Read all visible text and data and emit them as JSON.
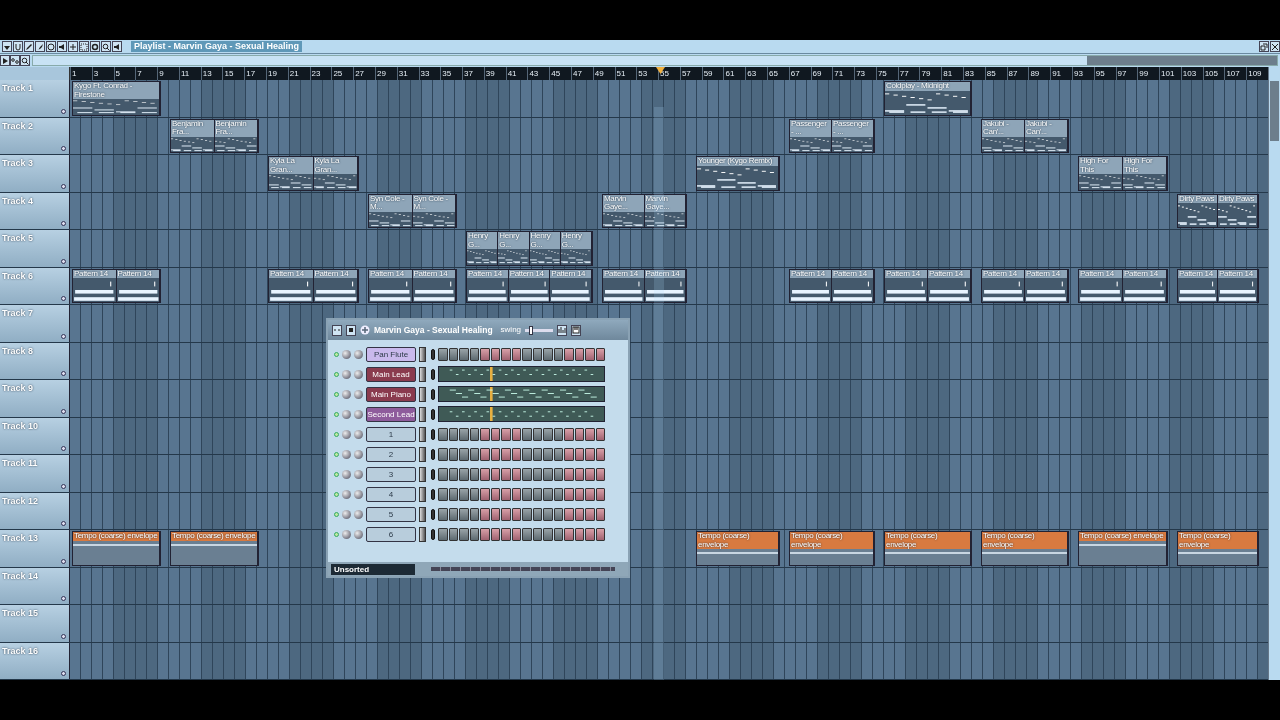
{
  "window": {
    "title": "Playlist - Marvin Gaya - Sexual Healing"
  },
  "ruler": {
    "marks": [
      "1",
      "3",
      "5",
      "7",
      "9",
      "11",
      "13",
      "15",
      "17",
      "19",
      "21",
      "23",
      "25",
      "27",
      "29",
      "31",
      "33",
      "35",
      "37",
      "39",
      "41",
      "43",
      "45",
      "47",
      "49",
      "51",
      "53",
      "55",
      "57",
      "59",
      "61",
      "63",
      "65",
      "67",
      "69",
      "71",
      "73",
      "75",
      "77",
      "79",
      "81",
      "83",
      "85",
      "87",
      "89",
      "91",
      "93",
      "95",
      "97",
      "99",
      "101",
      "103",
      "105",
      "107",
      "109"
    ]
  },
  "tracks": [
    {
      "name": "Track 1",
      "lane": [
        {
          "kind": "clip",
          "parts": [
            "Kygo Ft. Conrad - Firestone"
          ]
        },
        {
          "kind": "empty"
        },
        {
          "kind": "empty"
        },
        {
          "kind": "empty"
        },
        {
          "kind": "empty"
        },
        {
          "kind": "empty"
        },
        {
          "kind": "empty"
        },
        {
          "kind": "empty"
        },
        {
          "kind": "clip",
          "parts": [
            "Coldplay - Midnight"
          ]
        }
      ]
    },
    {
      "name": "Track 2",
      "lane": [
        {
          "kind": "empty"
        },
        {
          "kind": "clip",
          "parts": [
            "Benjamin Fra...",
            "Benjamin Fra..."
          ]
        },
        {
          "kind": "empty"
        },
        {
          "kind": "empty"
        },
        {
          "kind": "empty"
        },
        {
          "kind": "empty"
        },
        {
          "kind": "empty"
        },
        {
          "kind": "clip",
          "parts": [
            "Passenger - ...",
            "Passenger - ..."
          ]
        },
        {
          "kind": "empty"
        },
        {
          "kind": "clip",
          "parts": [
            "Jakubi - Can'...",
            "Jakubi - Can'..."
          ]
        }
      ]
    },
    {
      "name": "Track 3",
      "lane": [
        {
          "kind": "empty"
        },
        {
          "kind": "empty"
        },
        {
          "kind": "clip",
          "parts": [
            "Kyla La Gran...",
            "Kyla La Gran..."
          ]
        },
        {
          "kind": "empty"
        },
        {
          "kind": "empty"
        },
        {
          "kind": "empty"
        },
        {
          "kind": "clip",
          "parts": [
            "Younger (Kygo Remix)"
          ]
        },
        {
          "kind": "empty"
        },
        {
          "kind": "empty"
        },
        {
          "kind": "empty"
        },
        {
          "kind": "clip",
          "parts": [
            "High For This",
            "High For This"
          ]
        }
      ]
    },
    {
      "name": "Track 4",
      "lane": [
        {
          "kind": "empty"
        },
        {
          "kind": "empty"
        },
        {
          "kind": "empty"
        },
        {
          "kind": "clip",
          "parts": [
            "Syn Cole - M...",
            "Syn Cole - M..."
          ]
        },
        {
          "kind": "empty"
        },
        {
          "kind": "clip",
          "parts": [
            "Marvin Gaye...",
            "Marvin Gaye..."
          ]
        },
        {
          "kind": "empty"
        },
        {
          "kind": "empty"
        },
        {
          "kind": "empty"
        },
        {
          "kind": "empty"
        },
        {
          "kind": "empty"
        },
        {
          "kind": "clip",
          "parts": [
            "Dirty Paws",
            "Dirty Paws"
          ]
        }
      ]
    },
    {
      "name": "Track 5",
      "lane": [
        {
          "kind": "empty"
        },
        {
          "kind": "empty"
        },
        {
          "kind": "empty"
        },
        {
          "kind": "empty"
        },
        {
          "kind": "clip",
          "parts": [
            "Henry G...",
            "Henry G...",
            "Henry G...",
            "Henry G..."
          ]
        }
      ]
    },
    {
      "name": "Track 6",
      "lane": [
        {
          "kind": "pattern",
          "parts": [
            "Pattern 14",
            "Pattern 14"
          ]
        },
        {
          "kind": "empty"
        },
        {
          "kind": "pattern",
          "parts": [
            "Pattern 14",
            "Pattern 14"
          ]
        },
        {
          "kind": "pattern",
          "parts": [
            "Pattern 14",
            "Pattern 14"
          ]
        },
        {
          "kind": "pattern",
          "parts": [
            "Pattern 14",
            "Pattern 14",
            "Pattern 14"
          ]
        },
        {
          "kind": "pattern",
          "parts": [
            "Pattern 14",
            "Pattern 14"
          ]
        },
        {
          "kind": "empty"
        },
        {
          "kind": "pattern",
          "parts": [
            "Pattern 14",
            "Pattern 14"
          ]
        },
        {
          "kind": "pattern",
          "parts": [
            "Pattern 14",
            "Pattern 14"
          ]
        },
        {
          "kind": "pattern",
          "parts": [
            "Pattern 14",
            "Pattern 14"
          ]
        },
        {
          "kind": "pattern",
          "parts": [
            "Pattern 14",
            "Pattern 14"
          ]
        },
        {
          "kind": "pattern",
          "parts": [
            "Pattern 14",
            "Pattern 14"
          ]
        }
      ]
    },
    {
      "name": "Track 7"
    },
    {
      "name": "Track 8"
    },
    {
      "name": "Track 9"
    },
    {
      "name": "Track 10"
    },
    {
      "name": "Track 11"
    },
    {
      "name": "Track 12"
    },
    {
      "name": "Track 13",
      "lane": [
        {
          "kind": "automation",
          "parts": [
            "Tempo (coarse) envelope"
          ]
        },
        {
          "kind": "automation",
          "parts": [
            "Tempo (coarse) envelope"
          ]
        },
        {
          "kind": "empty"
        },
        {
          "kind": "empty"
        },
        {
          "kind": "empty"
        },
        {
          "kind": "empty"
        },
        {
          "kind": "automation",
          "parts": [
            "Tempo (coarse) envelope"
          ]
        },
        {
          "kind": "automation",
          "parts": [
            "Tempo (coarse) envelope"
          ]
        },
        {
          "kind": "automation",
          "parts": [
            "Tempo (coarse) envelope"
          ]
        },
        {
          "kind": "automation",
          "parts": [
            "Tempo (coarse) envelope"
          ]
        },
        {
          "kind": "automation",
          "parts": [
            "Tempo (coarse) envelope"
          ]
        },
        {
          "kind": "automation",
          "parts": [
            "Tempo (coarse) envelope"
          ]
        }
      ]
    },
    {
      "name": "Track 14"
    },
    {
      "name": "Track 15"
    },
    {
      "name": "Track 16"
    }
  ],
  "channel_rack": {
    "title": "Marvin Gaya - Sexual Healing",
    "swing": {
      "label": "swing",
      "level": 0.15
    },
    "channels": [
      {
        "name": "Pan Flute",
        "kind": "steps",
        "color": "#c9b9ec"
      },
      {
        "name": "Main Lead",
        "kind": "pianoroll",
        "color": "#8a3b4e"
      },
      {
        "name": "Main Piano",
        "kind": "pianoroll",
        "color": "#8a3b4e"
      },
      {
        "name": "Second Lead",
        "kind": "pianoroll",
        "color": "#8e5c9c"
      },
      {
        "name": "1",
        "kind": "steps",
        "color": "#b8cddc"
      },
      {
        "name": "2",
        "kind": "steps",
        "color": "#b8cddc"
      },
      {
        "name": "3",
        "kind": "steps",
        "color": "#b8cddc"
      },
      {
        "name": "4",
        "kind": "steps",
        "color": "#b8cddc"
      },
      {
        "name": "5",
        "kind": "steps",
        "color": "#b8cddc"
      },
      {
        "name": "6",
        "kind": "steps",
        "color": "#b8cddc"
      }
    ],
    "filter": "Unsorted"
  }
}
